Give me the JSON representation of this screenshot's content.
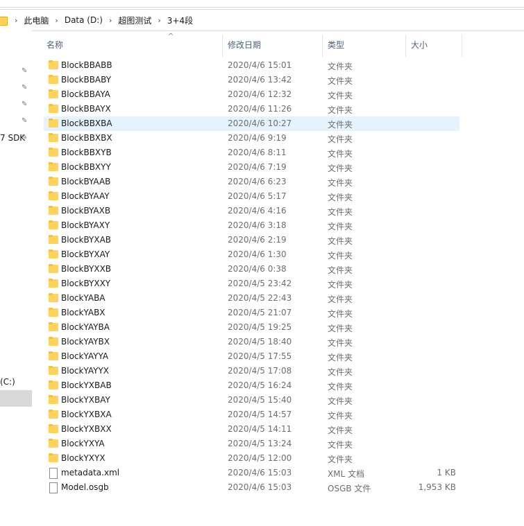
{
  "address": {
    "crumbs": [
      "此电脑",
      "Data (D:)",
      "超图测试",
      "3+4段"
    ]
  },
  "nav": {
    "sdk_label": "7 SDK",
    "drive_label": "(C:)"
  },
  "columns": {
    "name": "名称",
    "date": "修改日期",
    "type": "类型",
    "size": "大小"
  },
  "files": [
    {
      "name": "BlockBBABB",
      "date": "2020/4/6 15:01",
      "type": "文件夹",
      "size": "",
      "kind": "folder"
    },
    {
      "name": "BlockBBABY",
      "date": "2020/4/6 13:42",
      "type": "文件夹",
      "size": "",
      "kind": "folder"
    },
    {
      "name": "BlockBBAYA",
      "date": "2020/4/6 12:32",
      "type": "文件夹",
      "size": "",
      "kind": "folder"
    },
    {
      "name": "BlockBBAYX",
      "date": "2020/4/6 11:26",
      "type": "文件夹",
      "size": "",
      "kind": "folder"
    },
    {
      "name": "BlockBBXBA",
      "date": "2020/4/6 10:27",
      "type": "文件夹",
      "size": "",
      "kind": "folder",
      "selected": true
    },
    {
      "name": "BlockBBXBX",
      "date": "2020/4/6 9:19",
      "type": "文件夹",
      "size": "",
      "kind": "folder"
    },
    {
      "name": "BlockBBXYB",
      "date": "2020/4/6 8:11",
      "type": "文件夹",
      "size": "",
      "kind": "folder"
    },
    {
      "name": "BlockBBXYY",
      "date": "2020/4/6 7:19",
      "type": "文件夹",
      "size": "",
      "kind": "folder"
    },
    {
      "name": "BlockBYAAB",
      "date": "2020/4/6 6:23",
      "type": "文件夹",
      "size": "",
      "kind": "folder"
    },
    {
      "name": "BlockBYAAY",
      "date": "2020/4/6 5:17",
      "type": "文件夹",
      "size": "",
      "kind": "folder"
    },
    {
      "name": "BlockBYAXB",
      "date": "2020/4/6 4:16",
      "type": "文件夹",
      "size": "",
      "kind": "folder"
    },
    {
      "name": "BlockBYAXY",
      "date": "2020/4/6 3:18",
      "type": "文件夹",
      "size": "",
      "kind": "folder"
    },
    {
      "name": "BlockBYXAB",
      "date": "2020/4/6 2:19",
      "type": "文件夹",
      "size": "",
      "kind": "folder"
    },
    {
      "name": "BlockBYXAY",
      "date": "2020/4/6 1:30",
      "type": "文件夹",
      "size": "",
      "kind": "folder"
    },
    {
      "name": "BlockBYXXB",
      "date": "2020/4/6 0:38",
      "type": "文件夹",
      "size": "",
      "kind": "folder"
    },
    {
      "name": "BlockBYXXY",
      "date": "2020/4/5 23:42",
      "type": "文件夹",
      "size": "",
      "kind": "folder"
    },
    {
      "name": "BlockYABA",
      "date": "2020/4/5 22:43",
      "type": "文件夹",
      "size": "",
      "kind": "folder"
    },
    {
      "name": "BlockYABX",
      "date": "2020/4/5 21:07",
      "type": "文件夹",
      "size": "",
      "kind": "folder"
    },
    {
      "name": "BlockYAYBA",
      "date": "2020/4/5 19:25",
      "type": "文件夹",
      "size": "",
      "kind": "folder"
    },
    {
      "name": "BlockYAYBX",
      "date": "2020/4/5 18:40",
      "type": "文件夹",
      "size": "",
      "kind": "folder"
    },
    {
      "name": "BlockYAYYA",
      "date": "2020/4/5 17:55",
      "type": "文件夹",
      "size": "",
      "kind": "folder"
    },
    {
      "name": "BlockYAYYX",
      "date": "2020/4/5 17:08",
      "type": "文件夹",
      "size": "",
      "kind": "folder"
    },
    {
      "name": "BlockYXBAB",
      "date": "2020/4/5 16:24",
      "type": "文件夹",
      "size": "",
      "kind": "folder"
    },
    {
      "name": "BlockYXBAY",
      "date": "2020/4/5 15:40",
      "type": "文件夹",
      "size": "",
      "kind": "folder"
    },
    {
      "name": "BlockYXBXA",
      "date": "2020/4/5 14:57",
      "type": "文件夹",
      "size": "",
      "kind": "folder"
    },
    {
      "name": "BlockYXBXX",
      "date": "2020/4/5 14:11",
      "type": "文件夹",
      "size": "",
      "kind": "folder"
    },
    {
      "name": "BlockYXYA",
      "date": "2020/4/5 13:24",
      "type": "文件夹",
      "size": "",
      "kind": "folder"
    },
    {
      "name": "BlockYXYX",
      "date": "2020/4/5 12:00",
      "type": "文件夹",
      "size": "",
      "kind": "folder"
    },
    {
      "name": "metadata.xml",
      "date": "2020/4/6 15:03",
      "type": "XML 文档",
      "size": "1 KB",
      "kind": "file"
    },
    {
      "name": "Model.osgb",
      "date": "2020/4/6 15:03",
      "type": "OSGB 文件",
      "size": "1,953 KB",
      "kind": "file"
    }
  ]
}
